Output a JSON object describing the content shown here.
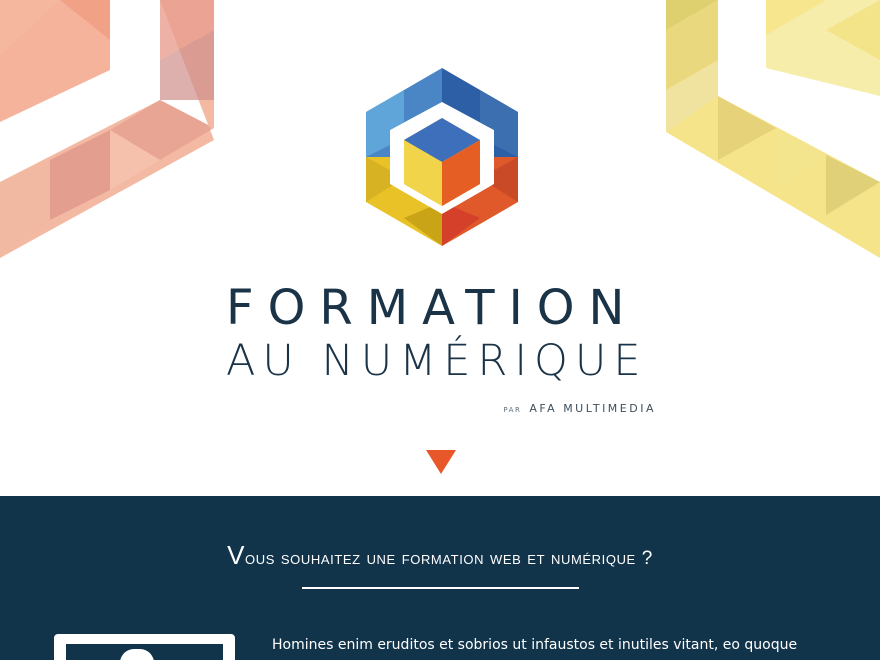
{
  "hero": {
    "title_line1": "FORMATION",
    "title_line2": "AU NUMÉRIQUE",
    "byline_par": "PAR",
    "byline_brand": "AFA MULTIMEDIA",
    "logo_icon": "hexagon-cube-logo-icon",
    "scroll_icon": "chevron-down-icon"
  },
  "colors": {
    "navy": "#12344b",
    "title": "#1a3347",
    "accent_orange": "#e8572a",
    "deco_salmon": "#f2a98c",
    "deco_yellow": "#f3e27a"
  },
  "section": {
    "heading": "Vous souhaitez une formation web et numérique ?",
    "body": "Homines enim eruditos et sobrios ut infaustos et inutiles vitant, eo quoque"
  }
}
